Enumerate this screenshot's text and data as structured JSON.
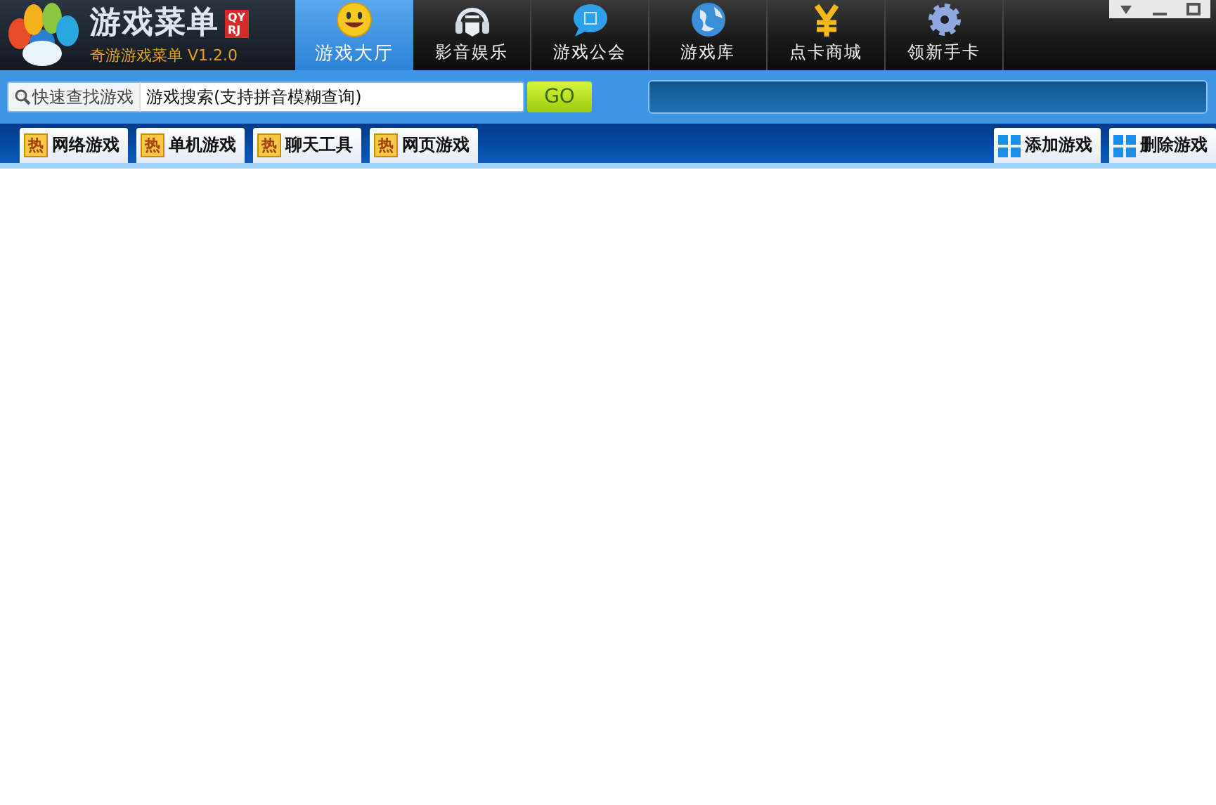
{
  "logo": {
    "title": "游戏菜单",
    "badge_top": "QY",
    "badge_bottom": "RJ",
    "subtitle": "奇游游戏菜单 V1.2.0"
  },
  "nav": [
    {
      "label": "游戏大厅",
      "kind": "smiley",
      "selected": true
    },
    {
      "label": "影音娱乐",
      "kind": "headphones",
      "selected": false
    },
    {
      "label": "游戏公会",
      "kind": "bubble",
      "selected": false
    },
    {
      "label": "游戏库",
      "kind": "globe",
      "selected": false
    },
    {
      "label": "点卡商城",
      "kind": "yen",
      "selected": false
    },
    {
      "label": "领新手卡",
      "kind": "gear",
      "selected": false
    }
  ],
  "search": {
    "label": "快速查找游戏",
    "value": "游戏搜索(支持拼音模糊查询)",
    "button": "GO"
  },
  "categories": [
    {
      "badge": "热",
      "label": "网络游戏"
    },
    {
      "badge": "热",
      "label": "单机游戏"
    },
    {
      "badge": "热",
      "label": "聊天工具"
    },
    {
      "badge": "热",
      "label": "网页游戏"
    }
  ],
  "actions": [
    {
      "label": "添加游戏"
    },
    {
      "label": "删除游戏"
    }
  ]
}
